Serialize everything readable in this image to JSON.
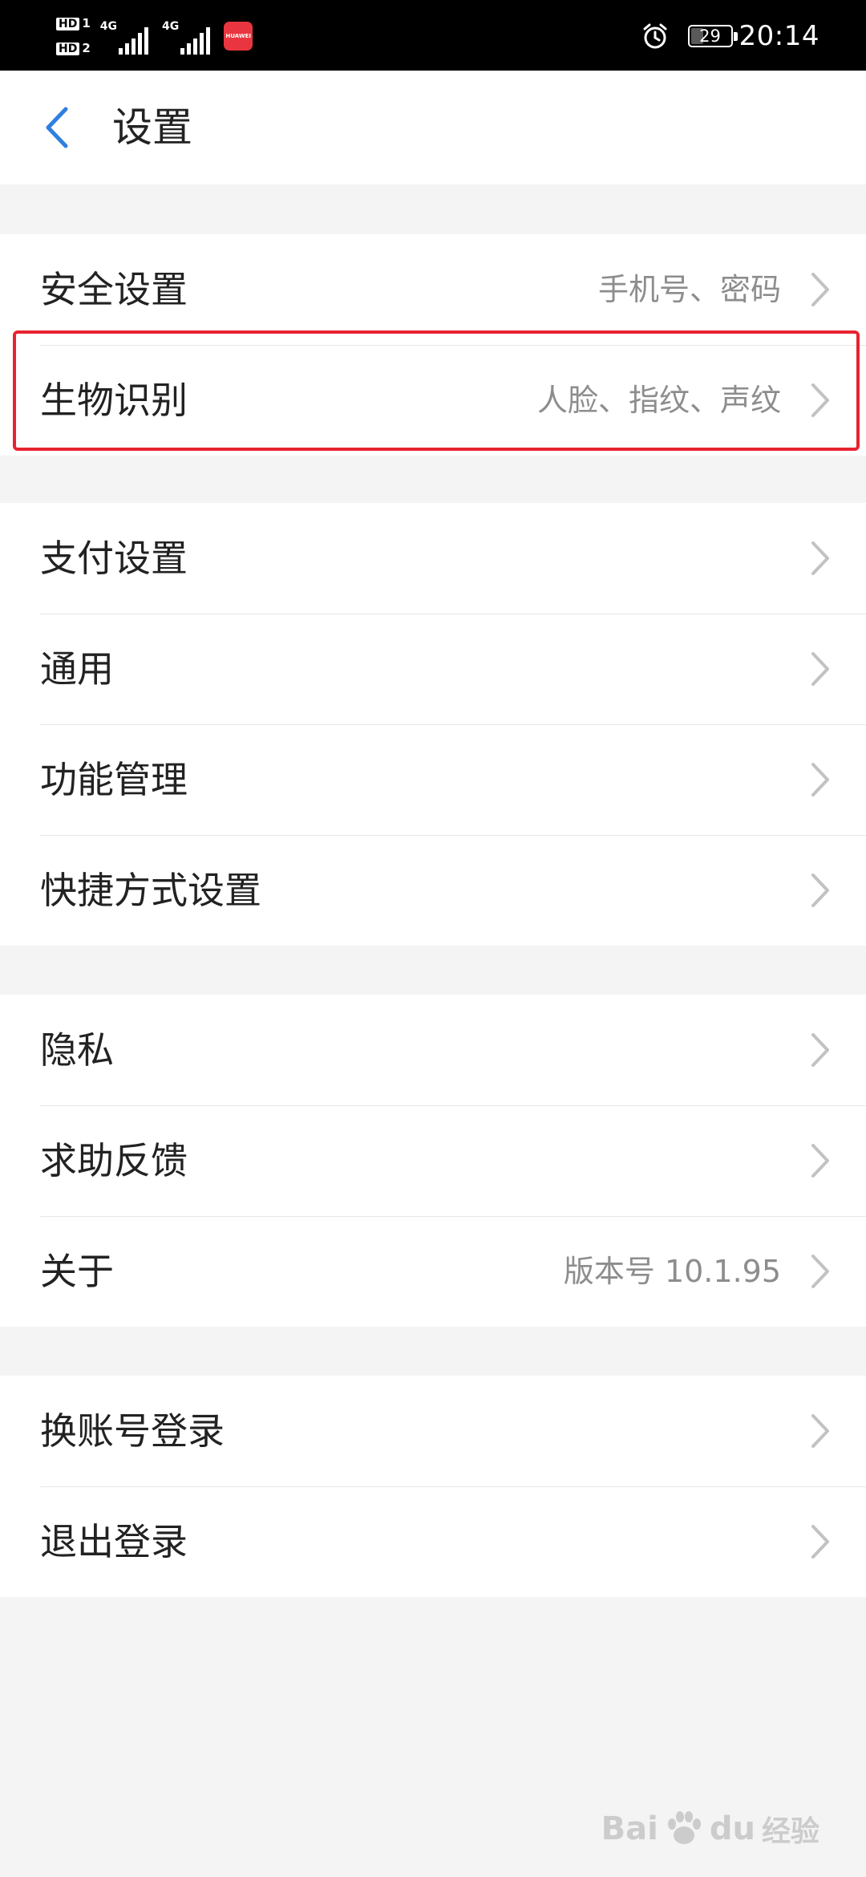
{
  "status_bar": {
    "sim1_label": "HD",
    "sim1_index": "1",
    "sim2_label": "HD",
    "sim2_index": "2",
    "network1": "4G",
    "network2": "4G",
    "app_badge": "HUAWEI",
    "battery_level": "29",
    "time": "20:14"
  },
  "header": {
    "title": "设置"
  },
  "groups": [
    {
      "items": [
        {
          "label": "安全设置",
          "value": "手机号、密码"
        },
        {
          "label": "生物识别",
          "value": "人脸、指纹、声纹"
        }
      ]
    },
    {
      "items": [
        {
          "label": "支付设置",
          "value": ""
        },
        {
          "label": "通用",
          "value": ""
        },
        {
          "label": "功能管理",
          "value": ""
        },
        {
          "label": "快捷方式设置",
          "value": ""
        }
      ]
    },
    {
      "items": [
        {
          "label": "隐私",
          "value": ""
        },
        {
          "label": "求助反馈",
          "value": ""
        },
        {
          "label": "关于",
          "value": "版本号 10.1.95"
        }
      ]
    },
    {
      "items": [
        {
          "label": "换账号登录",
          "value": ""
        },
        {
          "label": "退出登录",
          "value": ""
        }
      ]
    }
  ],
  "watermark": {
    "brand_left": "Bai",
    "brand_right": "du",
    "suffix": "经验"
  },
  "colors": {
    "accent": "#2f7fe0",
    "highlight": "#e8232f",
    "background": "#f4f4f4"
  }
}
